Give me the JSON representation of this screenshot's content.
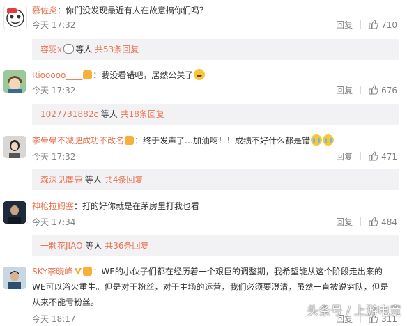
{
  "comments": [
    {
      "username": "慕佐炎",
      "text": "你们没发现最近有人在故意搞你们吗？",
      "time": "今天 17:32",
      "reply": "回复",
      "likes": "710",
      "replies": {
        "name": "容羽x",
        "suffix": "等人",
        "total": "共53条回复"
      }
    },
    {
      "username": "Riooooo____",
      "text": "我没看错吧，居然公关了",
      "time": "今天 17:32",
      "reply": "回复",
      "likes": "676",
      "replies": {
        "name": "1027731882c",
        "suffix": "等人",
        "total": "共18条回复"
      }
    },
    {
      "username": "李晕晕不减肥成功不改名",
      "text": "终于发声了…加油啊！！成绩不好什么都是错",
      "time": "今天 17:32",
      "reply": "回复",
      "likes": "471",
      "replies": {
        "name": "森深见麋鹿",
        "suffix": "等人",
        "total": "共4条回复"
      }
    },
    {
      "username": "神枪拉姆塞",
      "text": "打的好你就是在茅房里打我也看",
      "time": "今天 17:34",
      "reply": "回复",
      "likes": "484",
      "replies": {
        "name": "一颗花JIAO",
        "suffix": "等人",
        "total": "共36条回复"
      }
    },
    {
      "username": "SKY李晓峰",
      "text_line1": "WE的小伙子们都在经历着一个艰巨的调整期，我希望能从这个阶段走出来的",
      "text_line2": "WE可以浴火重生。但是对于粉丝，对于主场的运营，我们必须要澄清，虽然一直被说穷队，但是",
      "text_line3": "从来不能亏粉丝。",
      "time": "今天 18:17",
      "reply": "回复",
      "likes": "311"
    }
  ],
  "watermark": "头条号 / 上游电竞",
  "colors": {
    "username": "#eb7350",
    "meta": "#808080",
    "reply_box": "#f2f2f5",
    "badge": "#f7b13a"
  }
}
